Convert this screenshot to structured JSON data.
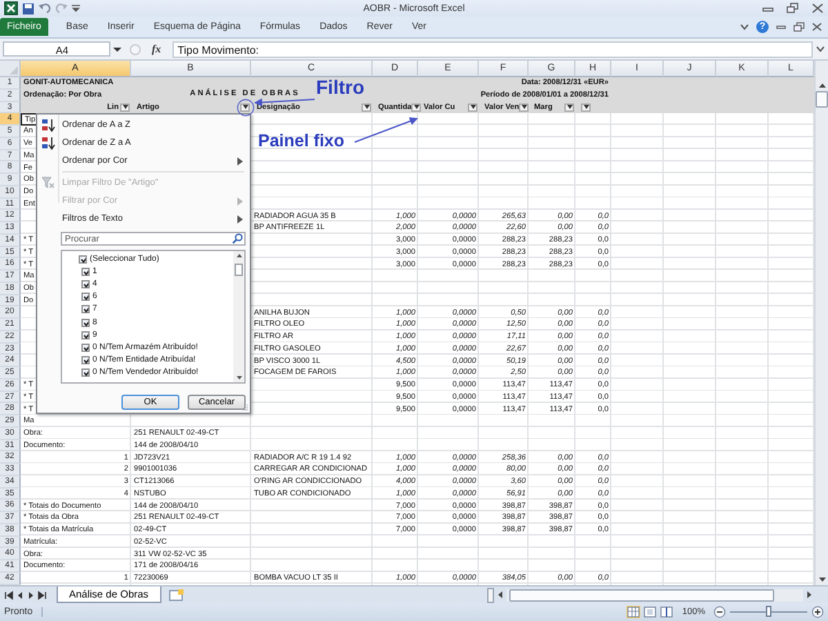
{
  "titlebar": {
    "title": "AOBR - Microsoft Excel"
  },
  "ribbon": {
    "tabs": [
      {
        "label": "Ficheiro",
        "kind": "file"
      },
      {
        "label": "Base",
        "kind": "tab"
      },
      {
        "label": "Inserir",
        "kind": "tab"
      },
      {
        "label": "Esquema de Página",
        "kind": "tab"
      },
      {
        "label": "Fórmulas",
        "kind": "tab"
      },
      {
        "label": "Dados",
        "kind": "tab"
      },
      {
        "label": "Rever",
        "kind": "tab"
      },
      {
        "label": "Ver",
        "kind": "tab"
      }
    ],
    "help": "?"
  },
  "formula_bar": {
    "name_box": "A4",
    "fx": "fx",
    "content": "Tipo Movimento:"
  },
  "columns": [
    {
      "label": "A",
      "selected": true
    },
    {
      "label": "B",
      "selected": false
    },
    {
      "label": "C",
      "selected": false
    },
    {
      "label": "D",
      "selected": false
    },
    {
      "label": "E",
      "selected": false
    },
    {
      "label": "F",
      "selected": false
    },
    {
      "label": "G",
      "selected": false
    },
    {
      "label": "H",
      "selected": false
    },
    {
      "label": "I",
      "selected": false
    },
    {
      "label": "J",
      "selected": false
    },
    {
      "label": "K",
      "selected": false
    },
    {
      "label": "L",
      "selected": false
    }
  ],
  "report_header": {
    "row_numbers": [
      "1",
      "2",
      "3"
    ],
    "company": "GONIT-AUTOMECANICA",
    "ordering": "Ordenação: Por Obra",
    "title": "ANÁLISE DE OBRAS",
    "date": "Data: 2008/12/31 «EUR»",
    "period": "Período de 2008/01/01 a 2008/12/31",
    "filters": [
      {
        "kind": "labeled",
        "label": "Lin"
      },
      {
        "kind": "labeled",
        "label": "Artigo"
      },
      {
        "kind": "labeled",
        "label": "Designação"
      },
      {
        "kind": "labeled",
        "label": "Quantida"
      },
      {
        "kind": "labeled",
        "label": "Valor Cu"
      },
      {
        "kind": "labeled",
        "label": "Valor Ven"
      },
      {
        "kind": "labeled",
        "label": "Marg"
      },
      {
        "kind": "button_only"
      }
    ]
  },
  "rows": [
    {
      "num": "4",
      "kind": "info",
      "selected": true,
      "a": "Tip"
    },
    {
      "num": "5",
      "kind": "info",
      "selected": false,
      "a": "An"
    },
    {
      "num": "6",
      "kind": "info",
      "selected": false,
      "a": "Ve"
    },
    {
      "num": "7",
      "kind": "info",
      "selected": false,
      "a": "Ma"
    },
    {
      "num": "8",
      "kind": "info",
      "selected": false,
      "a": "Fe"
    },
    {
      "num": "9",
      "kind": "info",
      "selected": false,
      "a": "Ob"
    },
    {
      "num": "10",
      "kind": "info",
      "selected": false,
      "a": "Do"
    },
    {
      "num": "11",
      "kind": "info",
      "selected": false,
      "a": "Ent"
    },
    {
      "num": "12",
      "kind": "item",
      "selected": false,
      "c": "RADIADOR AGUA 35 B",
      "d": "1,000",
      "e": "0,0000",
      "f": "265,63",
      "g": "0,00",
      "h": "0,0"
    },
    {
      "num": "13",
      "kind": "item",
      "selected": false,
      "c": "BP ANTIFREEZE 1L",
      "d": "2,000",
      "e": "0,0000",
      "f": "22,60",
      "g": "0,00",
      "h": "0,0"
    },
    {
      "num": "14",
      "kind": "total",
      "selected": false,
      "a": "* T",
      "d": "3,000",
      "e": "0,0000",
      "f": "288,23",
      "g": "288,23",
      "h": "0,0"
    },
    {
      "num": "15",
      "kind": "total",
      "selected": false,
      "a": "* T",
      "d": "3,000",
      "e": "0,0000",
      "f": "288,23",
      "g": "288,23",
      "h": "0,0"
    },
    {
      "num": "16",
      "kind": "total",
      "selected": false,
      "a": "* T",
      "d": "3,000",
      "e": "0,0000",
      "f": "288,23",
      "g": "288,23",
      "h": "0,0"
    },
    {
      "num": "17",
      "kind": "info",
      "selected": false,
      "a": "Ma"
    },
    {
      "num": "18",
      "kind": "info",
      "selected": false,
      "a": "Ob"
    },
    {
      "num": "19",
      "kind": "info",
      "selected": false,
      "a": "Do"
    },
    {
      "num": "20",
      "kind": "item",
      "selected": false,
      "c": "ANILHA BUJON",
      "d": "1,000",
      "e": "0,0000",
      "f": "0,50",
      "g": "0,00",
      "h": "0,0"
    },
    {
      "num": "21",
      "kind": "item",
      "selected": false,
      "c": "FILTRO OLEO",
      "d": "1,000",
      "e": "0,0000",
      "f": "12,50",
      "g": "0,00",
      "h": "0,0"
    },
    {
      "num": "22",
      "kind": "item",
      "selected": false,
      "c": "FILTRO AR",
      "d": "1,000",
      "e": "0,0000",
      "f": "17,11",
      "g": "0,00",
      "h": "0,0"
    },
    {
      "num": "23",
      "kind": "item",
      "selected": false,
      "c": "FILTRO GASOLEO",
      "d": "1,000",
      "e": "0,0000",
      "f": "22,67",
      "g": "0,00",
      "h": "0,0"
    },
    {
      "num": "24",
      "kind": "item",
      "selected": false,
      "c": "BP VISCO 3000 1L",
      "d": "4,500",
      "e": "0,0000",
      "f": "50,19",
      "g": "0,00",
      "h": "0,0"
    },
    {
      "num": "25",
      "kind": "item",
      "selected": false,
      "c": "FOCAGEM DE FAROIS",
      "d": "1,000",
      "e": "0,0000",
      "f": "2,50",
      "g": "0,00",
      "h": "0,0"
    },
    {
      "num": "26",
      "kind": "total",
      "selected": false,
      "a": "* T",
      "d": "9,500",
      "e": "0,0000",
      "f": "113,47",
      "g": "113,47",
      "h": "0,0"
    },
    {
      "num": "27",
      "kind": "total",
      "selected": false,
      "a": "* T",
      "d": "9,500",
      "e": "0,0000",
      "f": "113,47",
      "g": "113,47",
      "h": "0,0"
    },
    {
      "num": "28",
      "kind": "total",
      "selected": false,
      "a": "* T",
      "d": "9,500",
      "e": "0,0000",
      "f": "113,47",
      "g": "113,47",
      "h": "0,0"
    },
    {
      "num": "29",
      "kind": "info",
      "selected": false,
      "a": "Ma"
    },
    {
      "num": "30",
      "kind": "info",
      "selected": false,
      "a": "Obra:",
      "b": "251 RENAULT 02-49-CT"
    },
    {
      "num": "31",
      "kind": "info",
      "selected": false,
      "a": "Documento:",
      "b": "144 de 2008/04/10"
    },
    {
      "num": "32",
      "kind": "item",
      "selected": false,
      "a": "1",
      "b": "JD723V21",
      "c": "RADIADOR A/C R 19 1.4 92",
      "d": "1,000",
      "e": "0,0000",
      "f": "258,36",
      "g": "0,00",
      "h": "0,0"
    },
    {
      "num": "33",
      "kind": "item",
      "selected": false,
      "a": "2",
      "b": "9901001036",
      "c": "CARREGAR AR CONDICIONAD",
      "d": "1,000",
      "e": "0,0000",
      "f": "80,00",
      "g": "0,00",
      "h": "0,0"
    },
    {
      "num": "34",
      "kind": "item",
      "selected": false,
      "a": "3",
      "b": "CT1213066",
      "c": "O'RING AR CONDICCIONADO",
      "d": "4,000",
      "e": "0,0000",
      "f": "3,60",
      "g": "0,00",
      "h": "0,0"
    },
    {
      "num": "35",
      "kind": "item",
      "selected": false,
      "a": "4",
      "b": "NSTUBO",
      "c": "TUBO AR CONDICIONADO",
      "d": "1,000",
      "e": "0,0000",
      "f": "56,91",
      "g": "0,00",
      "h": "0,0"
    },
    {
      "num": "36",
      "kind": "total",
      "selected": false,
      "a": "* Totais do Documento",
      "b": "144 de 2008/04/10",
      "d": "7,000",
      "e": "0,0000",
      "f": "398,87",
      "g": "398,87",
      "h": "0,0"
    },
    {
      "num": "37",
      "kind": "total",
      "selected": false,
      "a": "* Totais da Obra",
      "b": "251 RENAULT 02-49-CT",
      "d": "7,000",
      "e": "0,0000",
      "f": "398,87",
      "g": "398,87",
      "h": "0,0"
    },
    {
      "num": "38",
      "kind": "total",
      "selected": false,
      "a": "* Totais da Matrícula",
      "b": "02-49-CT",
      "d": "7,000",
      "e": "0,0000",
      "f": "398,87",
      "g": "398,87",
      "h": "0,0"
    },
    {
      "num": "39",
      "kind": "info",
      "selected": false,
      "a": "Matrícula:",
      "b": "02-52-VC"
    },
    {
      "num": "40",
      "kind": "info",
      "selected": false,
      "a": "Obra:",
      "b": "311 VW 02-52-VC 35"
    },
    {
      "num": "41",
      "kind": "info",
      "selected": false,
      "a": "Documento:",
      "b": "171 de 2008/04/16"
    },
    {
      "num": "42",
      "kind": "item",
      "selected": false,
      "a": "1",
      "b": "72230069",
      "c": "BOMBA VACUO LT 35 II",
      "d": "1,000",
      "e": "0,0000",
      "f": "384,05",
      "g": "0,00",
      "h": "0,0"
    }
  ],
  "filter_menu": {
    "items": [
      {
        "label": "Ordenar de A a Z",
        "kind": "sort_asc",
        "disabled": false,
        "submenu": false,
        "separator_before": false
      },
      {
        "label": "Ordenar de Z a A",
        "kind": "sort_desc",
        "disabled": false,
        "submenu": false,
        "separator_before": false
      },
      {
        "label": "Ordenar por Cor",
        "kind": "plain",
        "disabled": false,
        "submenu": true,
        "separator_before": false
      },
      {
        "label": "Limpar Filtro De \"Artigo\"",
        "kind": "clear_filter",
        "disabled": true,
        "submenu": false,
        "separator_before": true
      },
      {
        "label": "Filtrar por Cor",
        "kind": "plain",
        "disabled": true,
        "submenu": true,
        "separator_before": false
      },
      {
        "label": "Filtros de Texto",
        "kind": "plain",
        "disabled": false,
        "submenu": true,
        "separator_before": false
      }
    ],
    "search": {
      "placeholder": "Procurar"
    },
    "values": [
      {
        "label": "(Seleccionar Tudo)",
        "checked": true
      },
      {
        "label": "1",
        "checked": true
      },
      {
        "label": "4",
        "checked": true
      },
      {
        "label": "6",
        "checked": true
      },
      {
        "label": "7",
        "checked": true
      },
      {
        "label": "8",
        "checked": true
      },
      {
        "label": "9",
        "checked": true
      },
      {
        "label": "0 N/Tem Armazém Atribuído!",
        "checked": true
      },
      {
        "label": "0 N/Tem Entidade Atribuída!",
        "checked": true
      },
      {
        "label": "0 N/Tem Vendedor Atribuído!",
        "checked": true
      }
    ],
    "buttons": [
      {
        "label": "OK",
        "kind": "default"
      },
      {
        "label": "Cancelar",
        "kind": "normal"
      }
    ]
  },
  "annotations": [
    {
      "text": "Filtro",
      "kind": "filter"
    },
    {
      "text": "Painel fixo",
      "kind": "frozen_pane"
    }
  ],
  "sheet_tabs": [
    {
      "label": "Análise de Obras",
      "selected": true
    }
  ],
  "status_bar": {
    "text": "Pronto",
    "zoom": "100%",
    "zoom_slider": {
      "level": 0.5
    }
  }
}
